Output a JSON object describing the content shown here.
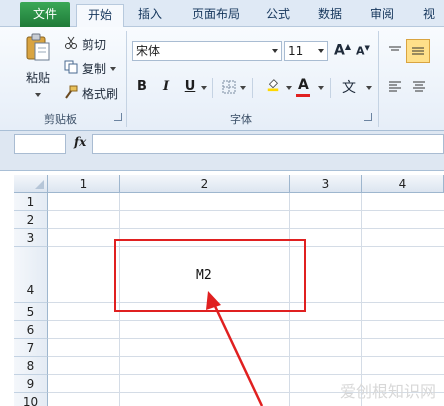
{
  "tabs": {
    "file": "文件",
    "home": "开始",
    "insert": "插入",
    "page_layout": "页面布局",
    "formulas": "公式",
    "data": "数据",
    "review": "审阅",
    "view": "视"
  },
  "clipboard": {
    "paste": "粘贴",
    "cut": "剪切",
    "copy": "复制",
    "format_painter": "格式刷",
    "group_label": "剪贴板"
  },
  "font": {
    "font_name": "宋体",
    "font_size": "11",
    "bold": "B",
    "italic": "I",
    "underline": "U",
    "group_label": "字体",
    "font_color": "#e02020",
    "fill_color": "#ffd800"
  },
  "formula_bar": {
    "fx": "fx",
    "name_box": "",
    "formula": ""
  },
  "sheet": {
    "columns": [
      "1",
      "2",
      "3",
      "4"
    ],
    "rows": [
      "1",
      "2",
      "3",
      "4",
      "5",
      "6",
      "7",
      "8",
      "9",
      "10"
    ],
    "cell_value": "M2"
  },
  "annotation": {
    "color": "#e02020"
  },
  "watermark": "爱创根知识网"
}
